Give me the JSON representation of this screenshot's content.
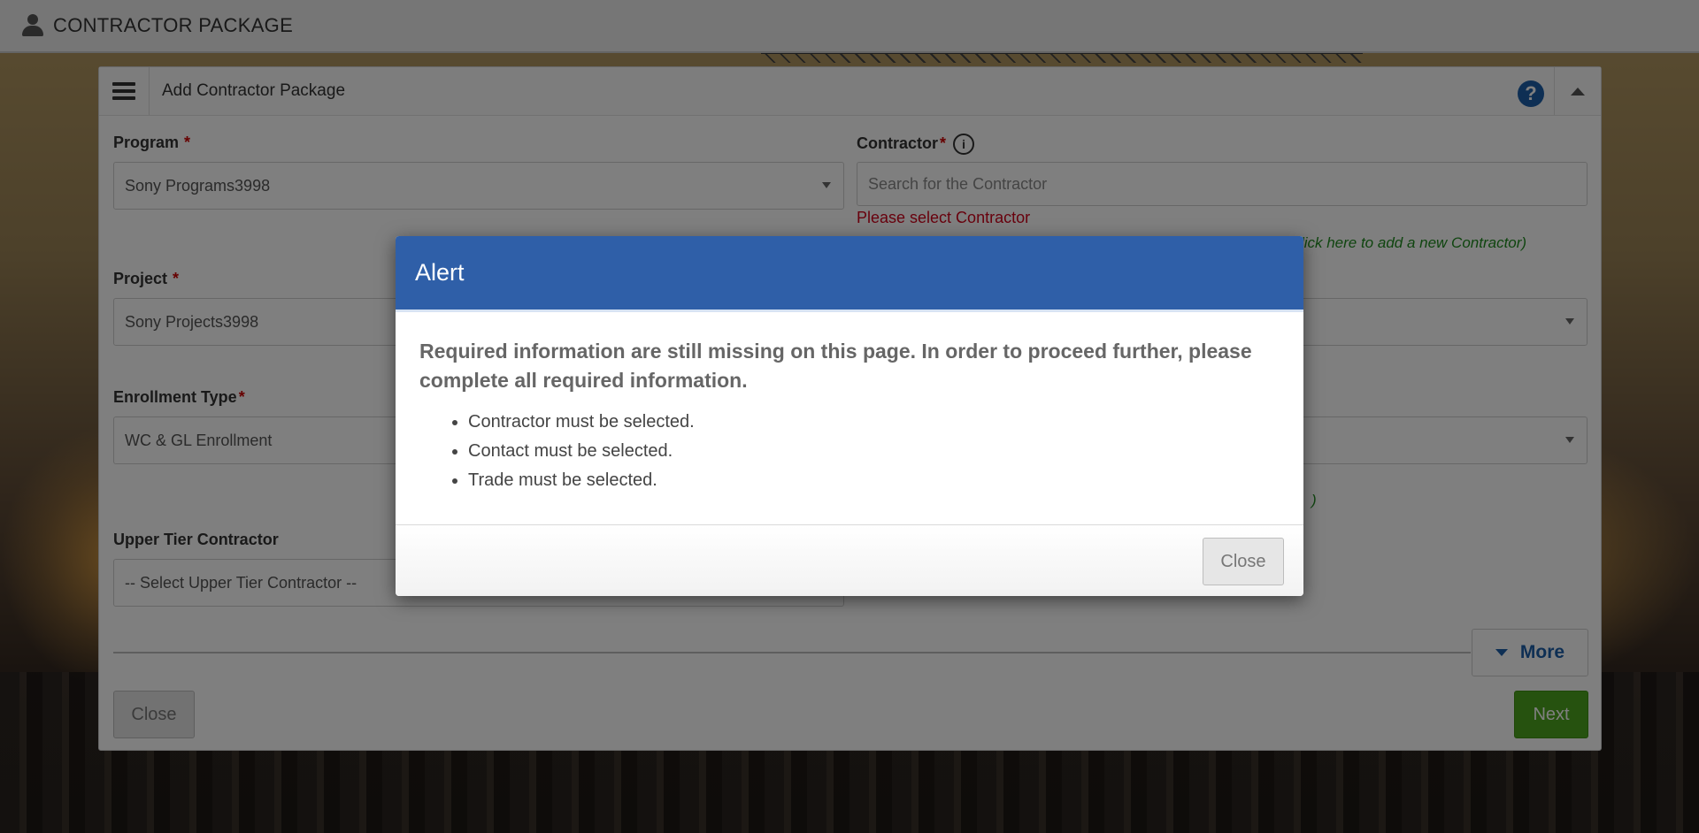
{
  "topbar": {
    "title": "CONTRACTOR PACKAGE",
    "icon": "user-icon"
  },
  "panel": {
    "title": "Add Contractor Package",
    "help_icon": "?",
    "fields": {
      "program": {
        "label": "Program",
        "required": "*",
        "value": "Sony Programs3998"
      },
      "contractor": {
        "label": "Contractor",
        "required": "*",
        "info_icon": "i",
        "placeholder": "Search for the Contractor",
        "error": "Please select Contractor",
        "hint": "(Click here to add a new Contractor)"
      },
      "project": {
        "label": "Project",
        "required": "*",
        "value": "Sony Projects3998"
      },
      "enrollment_type": {
        "label": "Enrollment Type",
        "required": "*",
        "value": "WC & GL Enrollment"
      },
      "upper_tier": {
        "label": "Upper Tier Contractor",
        "value": "-- Select Upper Tier Contractor --"
      },
      "hint_paren": ")"
    },
    "buttons": {
      "more": "More",
      "close": "Close",
      "next": "Next"
    }
  },
  "modal": {
    "title": "Alert",
    "message": "Required information are still missing on this page. In order to proceed further, please complete all required information.",
    "items": [
      "Contractor must be selected.",
      "Contact must be selected.",
      "Trade must be selected."
    ],
    "close": "Close"
  },
  "colors": {
    "primary": "#2f5fa8",
    "success": "#4da51f",
    "error": "#d0021b",
    "hint": "#1e8a1e"
  }
}
